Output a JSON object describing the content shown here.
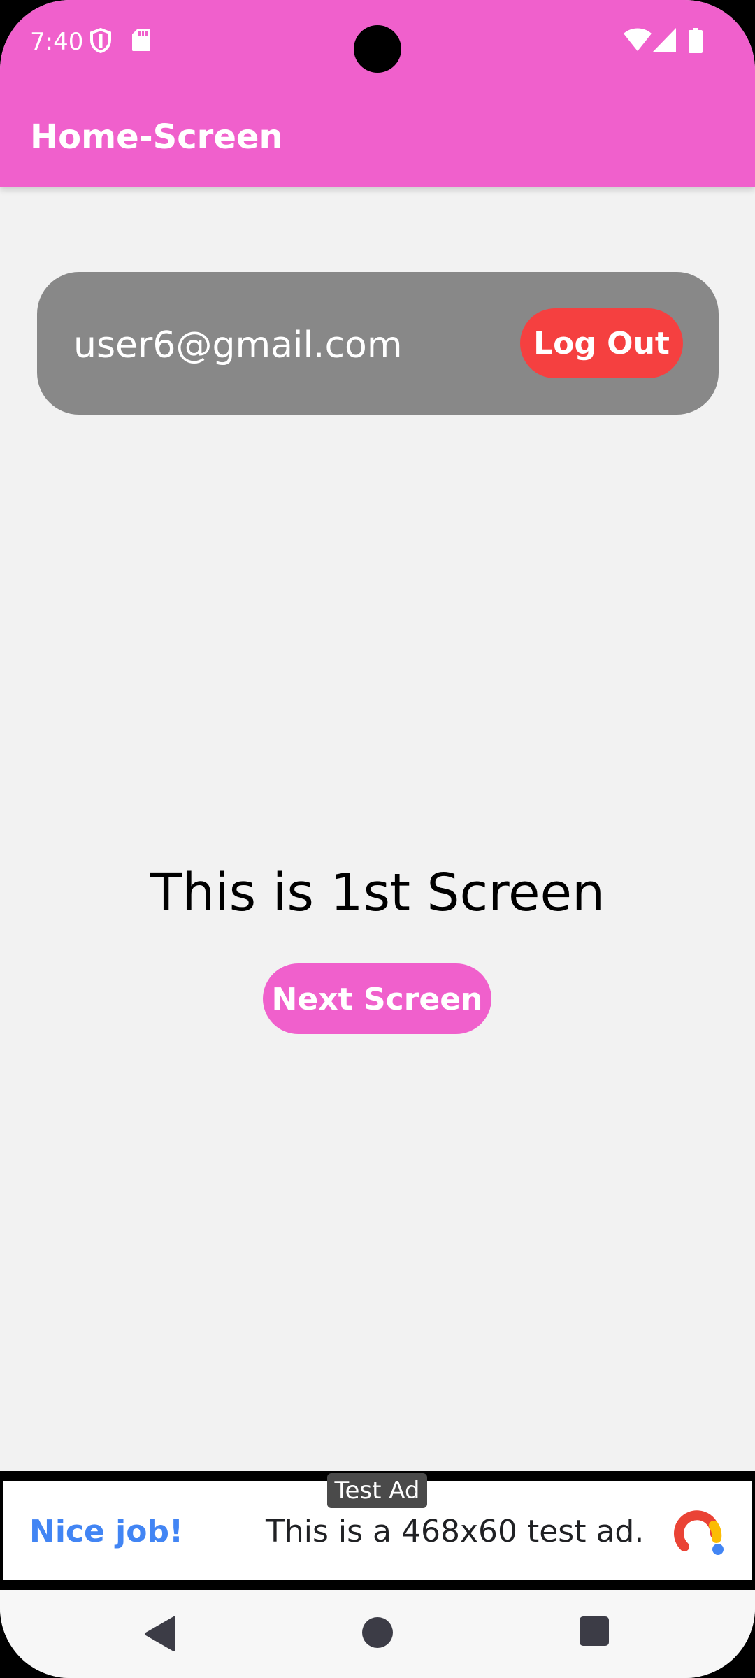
{
  "status_bar": {
    "time": "7:40",
    "icons": [
      "shield-icon",
      "sd-card-icon",
      "wifi-icon",
      "signal-icon",
      "battery-icon"
    ]
  },
  "app_bar": {
    "title": "Home-Screen",
    "color": "#f060cc"
  },
  "user_card": {
    "email": "user6@gmail.com",
    "logout_label": "Log Out",
    "logout_color": "#f54040"
  },
  "main": {
    "screen_label": "This is 1st Screen",
    "next_label": "Next Screen"
  },
  "ad": {
    "tag": "Test Ad",
    "headline": "Nice job!",
    "text": "This is a 468x60 test ad.",
    "logo_icon": "admob-logo-icon"
  },
  "nav_bar": {
    "icons": [
      "back-icon",
      "home-icon",
      "recents-icon"
    ]
  }
}
